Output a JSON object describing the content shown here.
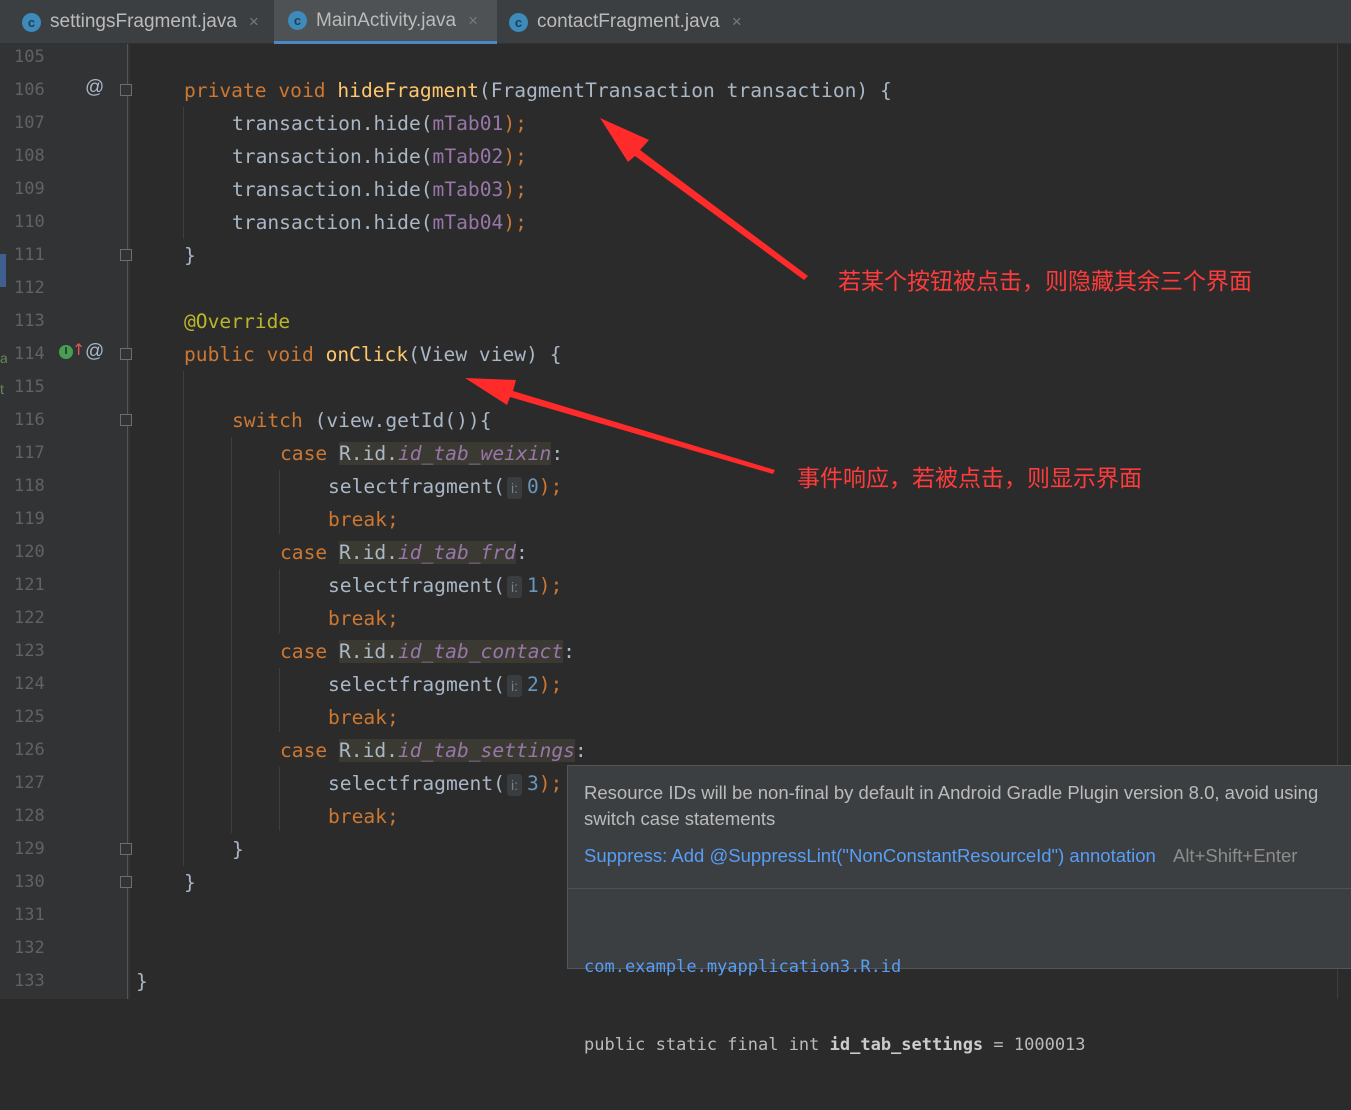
{
  "tabs": [
    {
      "name": "settingsFragment.java",
      "icon_letter": "c",
      "close": "×"
    },
    {
      "name": "MainActivity.java",
      "icon_letter": "c",
      "close": "×"
    },
    {
      "name": "contactFragment.java",
      "icon_letter": "c",
      "close": "×"
    }
  ],
  "active_tab": "MainActivity.java",
  "line_numbers": [
    "105",
    "106",
    "107",
    "108",
    "109",
    "110",
    "111",
    "112",
    "113",
    "114",
    "115",
    "116",
    "117",
    "118",
    "119",
    "120",
    "121",
    "122",
    "123",
    "124",
    "125",
    "126",
    "127",
    "128",
    "129",
    "130",
    "131",
    "132",
    "133"
  ],
  "gutter": {
    "override_marker": "@",
    "implements_marker": "I",
    "arrow_up": "↑",
    "edge_chars": [
      "a",
      "t"
    ]
  },
  "code": {
    "l106": {
      "mod": "private",
      "type": "void",
      "name": "hideFragment",
      "params": "(FragmentTransaction transaction) {"
    },
    "l107": {
      "pre": "transaction.hide(",
      "arg": "mTab01",
      "post": ");"
    },
    "l108": {
      "pre": "transaction.hide(",
      "arg": "mTab02",
      "post": ");"
    },
    "l109": {
      "pre": "transaction.hide(",
      "arg": "mTab03",
      "post": ");"
    },
    "l110": {
      "pre": "transaction.hide(",
      "arg": "mTab04",
      "post": ");"
    },
    "l111": "}",
    "l113": "@Override",
    "l114": {
      "mod": "public",
      "type": "void",
      "name": "onClick",
      "params": "(View view) {"
    },
    "l116": {
      "kw": "switch",
      "rest": " (view.getId()){"
    },
    "l117": {
      "kw": "case",
      "r": "R.id.",
      "id": "id_tab_weixin",
      "colon": ":"
    },
    "l118": {
      "call": "selectfragment(",
      "hint": "i:",
      "num": "0",
      "end": ");"
    },
    "l119": "break;",
    "l120": {
      "kw": "case",
      "r": "R.id.",
      "id": "id_tab_frd",
      "colon": ":"
    },
    "l121": {
      "call": "selectfragment(",
      "hint": "i:",
      "num": "1",
      "end": ");"
    },
    "l122": "break;",
    "l123": {
      "kw": "case",
      "r": "R.id.",
      "id": "id_tab_contact",
      "colon": ":"
    },
    "l124": {
      "call": "selectfragment(",
      "hint": "i:",
      "num": "2",
      "end": ");"
    },
    "l125": "break;",
    "l126": {
      "kw": "case",
      "r": "R.id.",
      "id": "id_tab_settings",
      "colon": ":"
    },
    "l127": {
      "call": "selectfragment(",
      "hint": "i:",
      "num": "3",
      "end": ");"
    },
    "l128": "break;",
    "l129": "}",
    "l130": "}",
    "l133": "}"
  },
  "annotations": {
    "hide_note": "若某个按钮被点击，则隐藏其余三个界面",
    "click_note": "事件响应，若被点击，则显示界面"
  },
  "popup": {
    "message": "Resource IDs will be non-final by default in Android Gradle Plugin version 8.0, avoid using",
    "message2": "switch case statements",
    "fix_link": "Suppress: Add @SuppressLint(\"NonConstantResourceId\") annotation",
    "fix_shortcut": "Alt+Shift+Enter",
    "decl_package": "com.example.myapplication3.R.id",
    "decl_prefix": "public static final int ",
    "decl_name": "id_tab_settings",
    "decl_suffix": " = 1000013"
  },
  "colors": {
    "editor_bg": "#2b2b2b",
    "keyword": "#cc7832",
    "method": "#ffc66d",
    "field": "#9876aa",
    "annotation": "#bbb529",
    "number": "#6897bb",
    "annotation_text": "#ff3b3b",
    "link": "#589df6"
  }
}
